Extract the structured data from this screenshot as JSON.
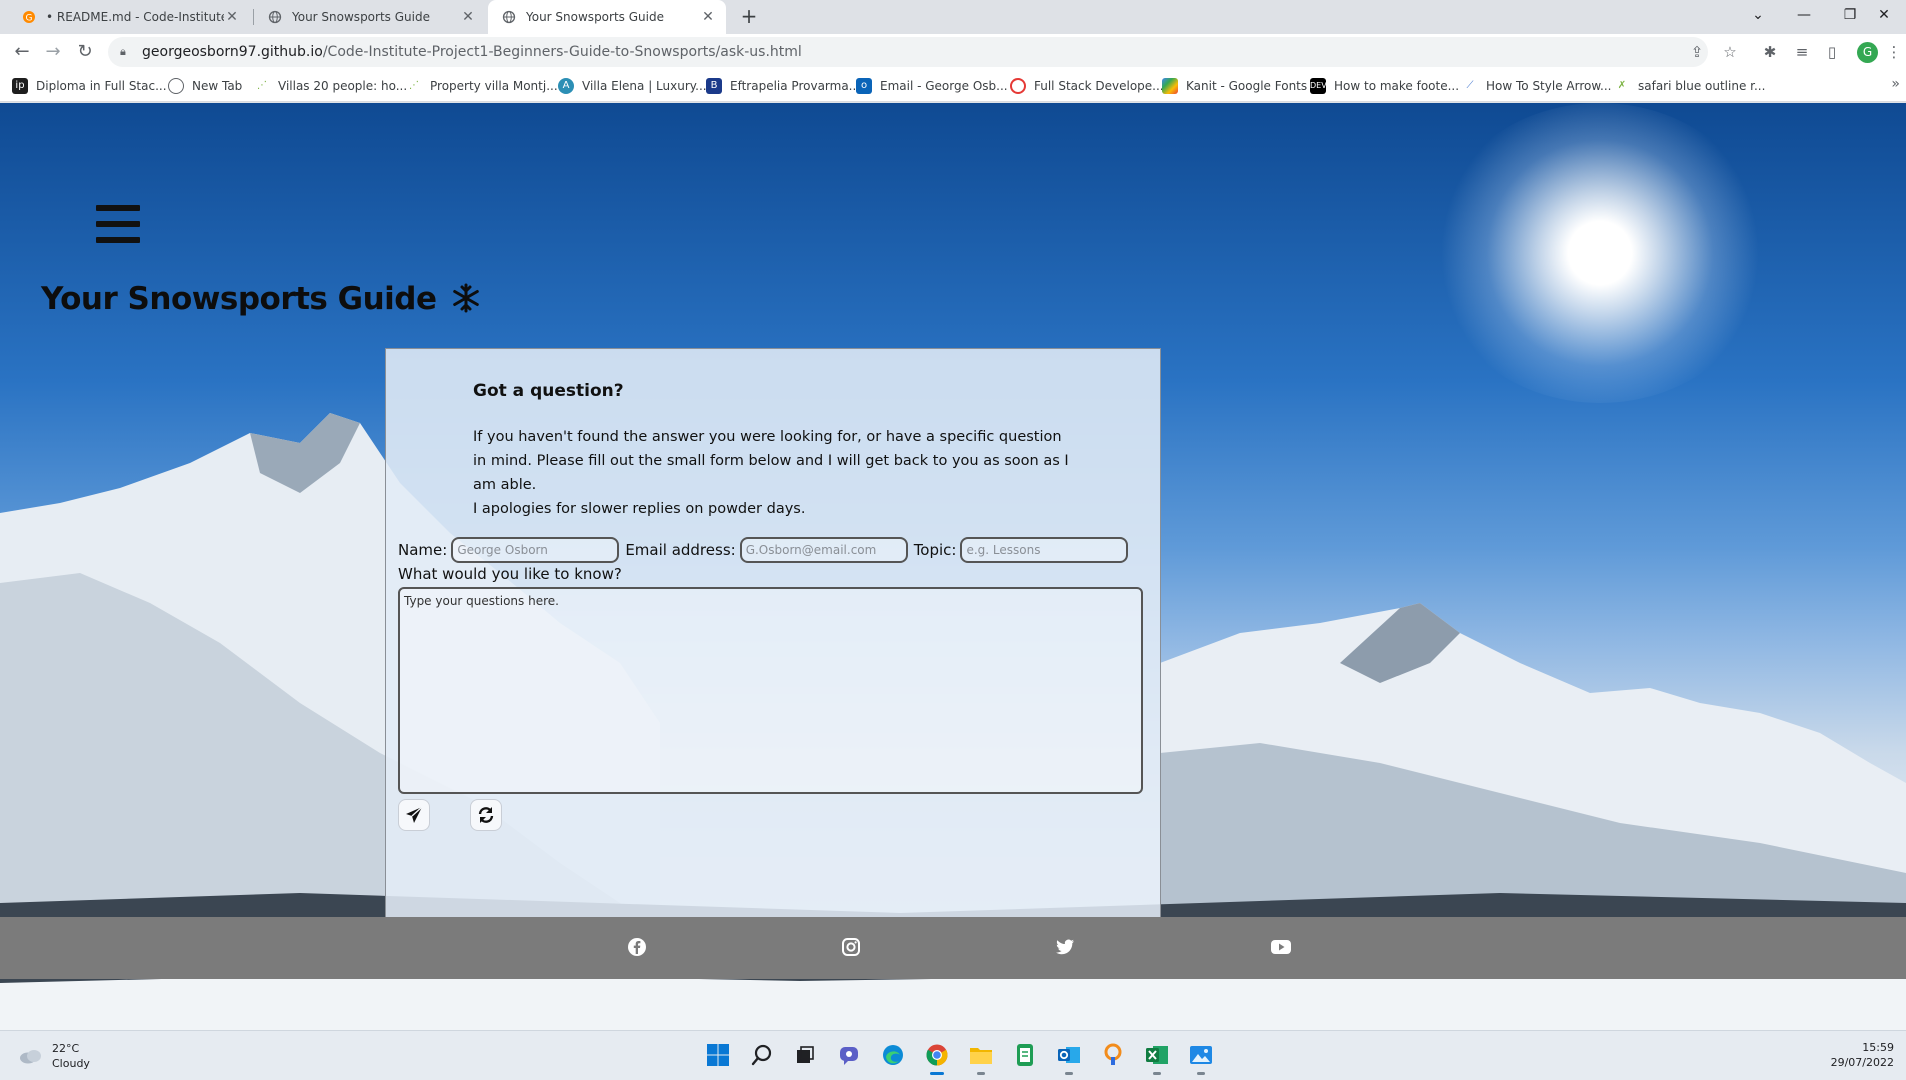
{
  "browser": {
    "tabs": [
      {
        "title": "• README.md - Code-Institute-P",
        "icon": "gitpod-icon"
      },
      {
        "title": "Your Snowsports Guide",
        "icon": "globe-icon"
      },
      {
        "title": "Your Snowsports Guide",
        "icon": "globe-icon",
        "active": true
      }
    ],
    "url_host": "georgeosborn97.github.io",
    "url_path": "/Code-Institute-Project1-Beginners-Guide-to-Snowsports/ask-us.html",
    "profile_initial": "G",
    "bookmarks": [
      "Diploma in Full Stac...",
      "New Tab",
      "Villas 20 people: ho...",
      "Property villa Montj...",
      "Villa Elena | Luxury...",
      "Eftrapelia Provarma...",
      "Email - George Osb...",
      "Full Stack Develope...",
      "Kanit - Google Fonts",
      "How to make foote...",
      "How To Style Arrow...",
      "safari blue outline r..."
    ]
  },
  "site": {
    "title": "Your Snowsports Guide",
    "title_icon": "snowflake-icon"
  },
  "form": {
    "heading": "Got a question?",
    "intro_line1": "If you haven't found the answer you were looking for, or have a specific question in mind. Please fill out the small form below and I will get back to you as soon as I am able.",
    "intro_line2": "I apologies for slower replies on powder days.",
    "name_label": "Name:",
    "name_placeholder": "George Osborn",
    "email_label": "Email address:",
    "email_placeholder": "G.Osborn@email.com",
    "topic_label": "Topic:",
    "topic_placeholder": "e.g. Lessons",
    "question_label": "What would you like to know?",
    "question_placeholder": "Type your questions here."
  },
  "footer": {
    "social": [
      "facebook-icon",
      "instagram-icon",
      "twitter-icon",
      "youtube-icon"
    ]
  },
  "taskbar": {
    "temperature": "22°C",
    "weather": "Cloudy",
    "time": "15:59",
    "date": "29/07/2022"
  }
}
